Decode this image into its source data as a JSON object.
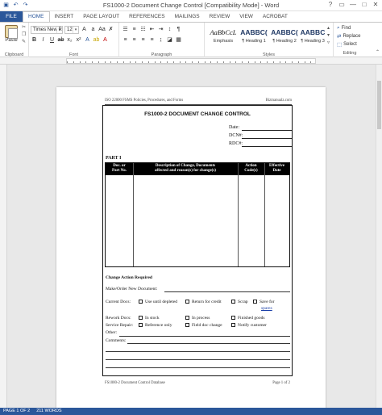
{
  "window": {
    "title": "FS1000-2 Document Change Control [Compatibility Mode] - Word"
  },
  "quick_access": [
    "save-icon",
    "undo-icon",
    "redo-icon"
  ],
  "window_controls": {
    "help": "?",
    "restore": "▭",
    "minimize": "—",
    "maximize": "□",
    "close": "✕"
  },
  "tabs": [
    "FILE",
    "HOME",
    "INSERT",
    "PAGE LAYOUT",
    "REFERENCES",
    "MAILINGS",
    "REVIEW",
    "VIEW",
    "ACROBAT"
  ],
  "ribbon": {
    "clipboard": {
      "paste_label": "Paste",
      "group_label": "Clipboard"
    },
    "font": {
      "name": "Times New R",
      "size": "12",
      "group_label": "Font"
    },
    "paragraph": {
      "group_label": "Paragraph"
    },
    "styles": {
      "group_label": "Styles",
      "items": [
        {
          "sample": "AaBbCcL",
          "name": "Emphasis"
        },
        {
          "sample": "AABBC(",
          "name": "¶ Heading 1"
        },
        {
          "sample": "AABBC(",
          "name": "¶ Heading 2"
        },
        {
          "sample": "AABBC",
          "name": "¶ Heading 3"
        }
      ]
    },
    "editing": {
      "find": "Find",
      "replace": "Replace",
      "select": "Select",
      "group_label": "Editing"
    }
  },
  "header": {
    "left": "ISO 22000 FSMS Policies, Procedures, and Forms",
    "right": "Bizmanualz.com"
  },
  "form": {
    "title": "FS1000-2 DOCUMENT CHANGE CONTROL",
    "date": "Date:",
    "dcn": "DCN#:",
    "rdc": "RDC#:",
    "part": "PART I",
    "columns": [
      {
        "line1": "Doc. or",
        "line2": "Part No."
      },
      {
        "line1": "Description of Change, Documents",
        "line2": "affected and reason(s) for change(s)"
      },
      {
        "line1": "Action",
        "line2": "Code(s)"
      },
      {
        "line1": "Effective",
        "line2": "Date"
      }
    ],
    "change_action": "Change Action Required",
    "make_order": "Make/Order New Document:",
    "current_docs": "Current Docs:",
    "use_until": "Use until depleted",
    "return_credit": "Return for credit",
    "scrap": "Scrap",
    "save_for": "Save for",
    "spares": "spares",
    "rework_docs": "Rework Docs:",
    "in_stock": "In stock",
    "in_process": "In process",
    "finished_goods": "Finished goods",
    "service_repair": "Service Repair:",
    "reference_only": "Reference only",
    "field_doc": "Field doc change",
    "notify_customer": "Notify customer",
    "other": "Other:",
    "comments": "Comments:"
  },
  "footer": {
    "left": "FS1000-2 Document Control Database",
    "right": "Page 1 of 2"
  },
  "status": {
    "page": "PAGE 1 OF 2",
    "words": "211 WORDS"
  }
}
